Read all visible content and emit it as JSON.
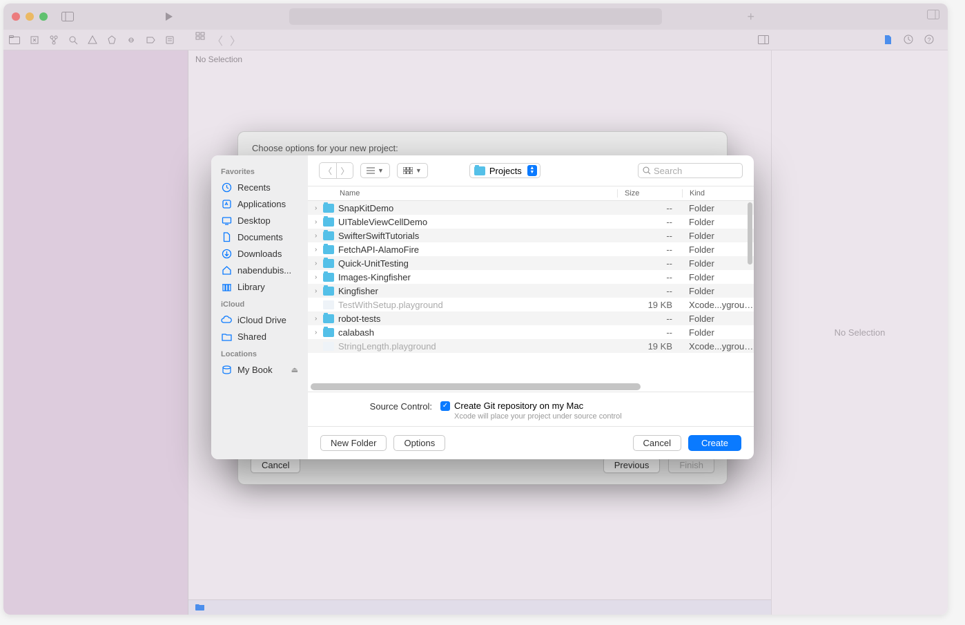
{
  "titlebar": {
    "plus": "+"
  },
  "breadcrumb": {
    "no_selection": "No Selection"
  },
  "inspector": {
    "no_selection": "No Selection"
  },
  "options_sheet": {
    "heading": "Choose options for your new project:",
    "cancel": "Cancel",
    "previous": "Previous",
    "finish": "Finish"
  },
  "dialog": {
    "sidebar": {
      "sections": [
        {
          "header": "Favorites",
          "items": [
            {
              "icon": "clock",
              "label": "Recents"
            },
            {
              "icon": "app",
              "label": "Applications"
            },
            {
              "icon": "desktop",
              "label": "Desktop"
            },
            {
              "icon": "doc",
              "label": "Documents"
            },
            {
              "icon": "download",
              "label": "Downloads"
            },
            {
              "icon": "home",
              "label": "nabendubis..."
            },
            {
              "icon": "library",
              "label": "Library"
            }
          ]
        },
        {
          "header": "iCloud",
          "items": [
            {
              "icon": "cloud",
              "label": "iCloud Drive"
            },
            {
              "icon": "shared",
              "label": "Shared"
            }
          ]
        },
        {
          "header": "Locations",
          "items": [
            {
              "icon": "disk",
              "label": "My Book",
              "eject": true
            }
          ]
        }
      ]
    },
    "toolbar": {
      "location": "Projects",
      "search_placeholder": "Search"
    },
    "columns": {
      "name": "Name",
      "size": "Size",
      "kind": "Kind"
    },
    "rows": [
      {
        "name": "SnapKitDemo",
        "size": "--",
        "kind": "Folder",
        "type": "folder"
      },
      {
        "name": "UITableViewCellDemo",
        "size": "--",
        "kind": "Folder",
        "type": "folder"
      },
      {
        "name": "SwifterSwiftTutorials",
        "size": "--",
        "kind": "Folder",
        "type": "folder"
      },
      {
        "name": "FetchAPI-AlamoFire",
        "size": "--",
        "kind": "Folder",
        "type": "folder"
      },
      {
        "name": "Quick-UnitTesting",
        "size": "--",
        "kind": "Folder",
        "type": "folder"
      },
      {
        "name": "Images-Kingfisher",
        "size": "--",
        "kind": "Folder",
        "type": "folder"
      },
      {
        "name": "Kingfisher",
        "size": "--",
        "kind": "Folder",
        "type": "folder"
      },
      {
        "name": "TestWithSetup.playground",
        "size": "19 KB",
        "kind": "Xcode...yground",
        "type": "playground",
        "dim": true
      },
      {
        "name": "robot-tests",
        "size": "--",
        "kind": "Folder",
        "type": "folder"
      },
      {
        "name": "calabash",
        "size": "--",
        "kind": "Folder",
        "type": "folder"
      },
      {
        "name": "StringLength.playground",
        "size": "19 KB",
        "kind": "Xcode...yground",
        "type": "playground",
        "dim": true
      }
    ],
    "source_control": {
      "label": "Source Control:",
      "checkbox_label": "Create Git repository on my Mac",
      "hint": "Xcode will place your project under source control"
    },
    "footer": {
      "new_folder": "New Folder",
      "options": "Options",
      "cancel": "Cancel",
      "create": "Create"
    }
  }
}
